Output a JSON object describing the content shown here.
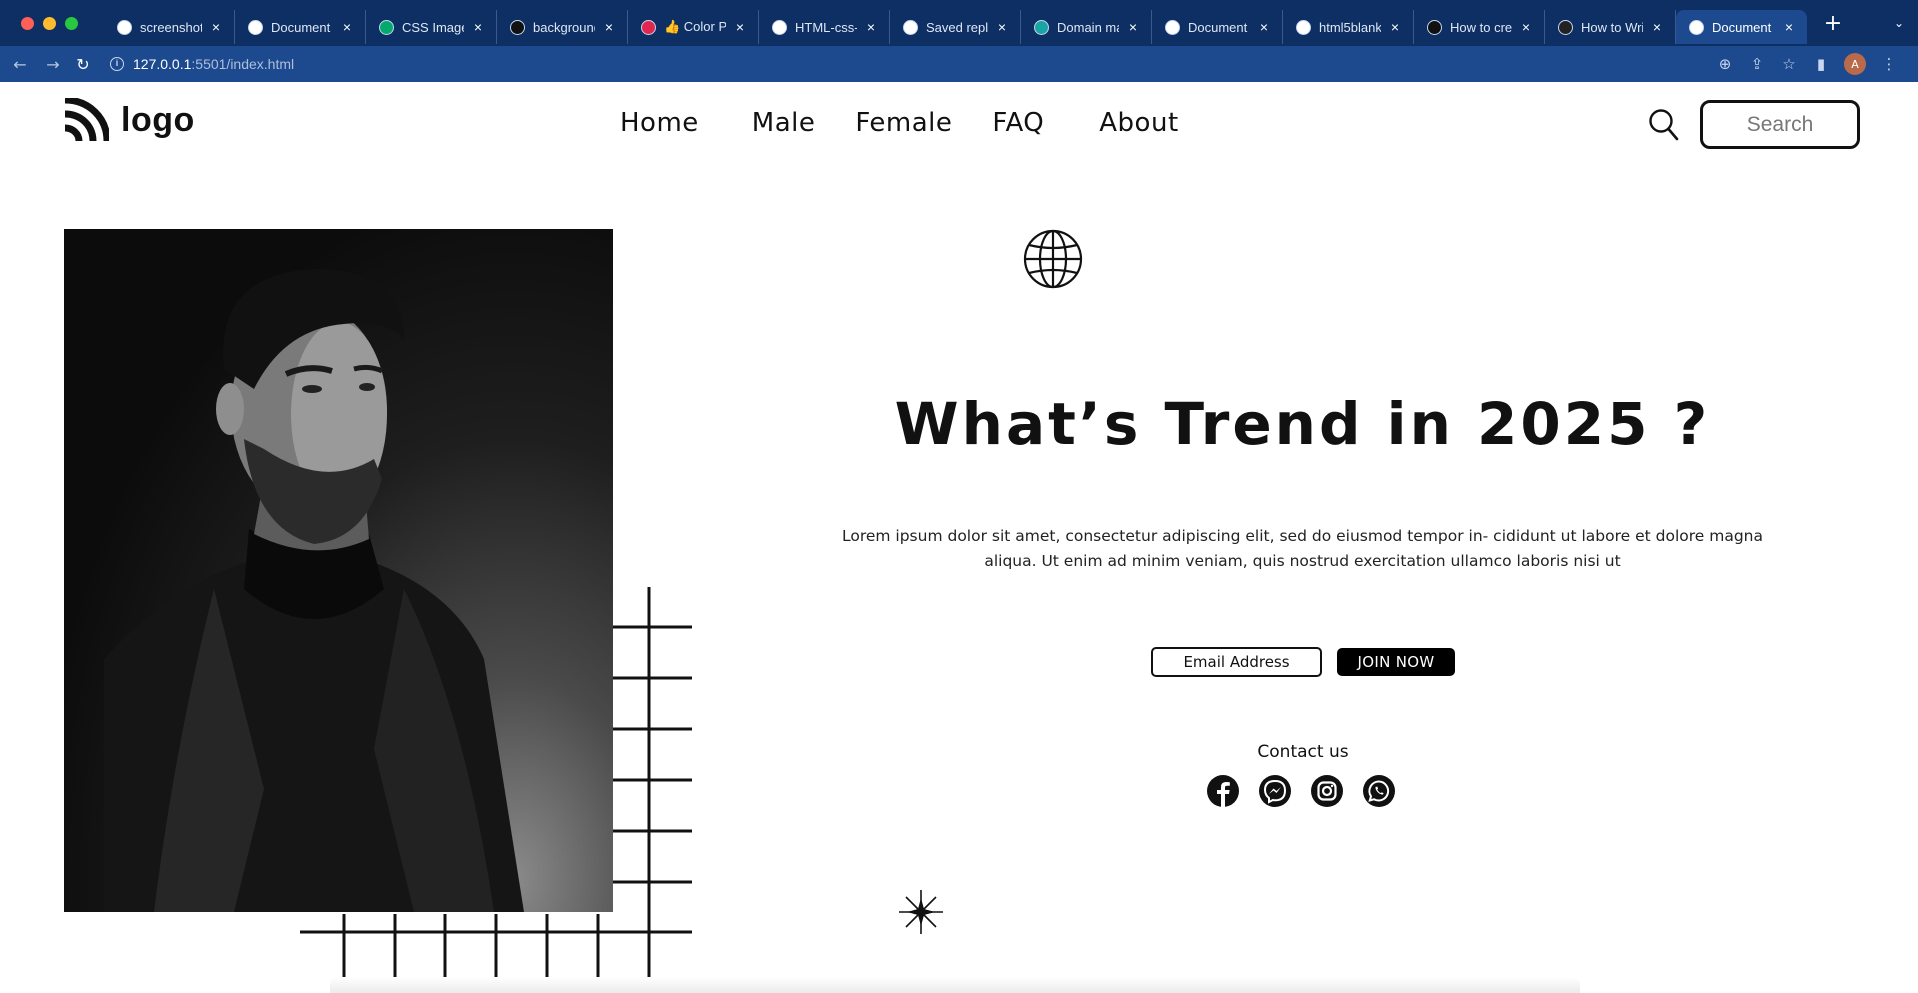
{
  "browser": {
    "tabs": [
      {
        "title": "screenshot",
        "favicon": "google-icon",
        "color": "#ffffff"
      },
      {
        "title": "Document",
        "favicon": "globe-icon",
        "color": "#ffffff"
      },
      {
        "title": "CSS Image",
        "favicon": "w3schools-icon",
        "color": "#04aa6d"
      },
      {
        "title": "background",
        "favicon": "medium-m-icon",
        "color": "#111111"
      },
      {
        "title": "👍 Color Pi",
        "favicon": "color-picker-icon",
        "color": "#e0264e"
      },
      {
        "title": "HTML-css-",
        "favicon": "github-icon",
        "color": "#ffffff"
      },
      {
        "title": "Saved repli",
        "favicon": "github-icon",
        "color": "#ffffff"
      },
      {
        "title": "Domain ma",
        "favicon": "diamond-icon",
        "color": "#1aa5a5"
      },
      {
        "title": "Document",
        "favicon": "globe-icon",
        "color": "#ffffff"
      },
      {
        "title": "html5blank",
        "favicon": "github-icon",
        "color": "#ffffff"
      },
      {
        "title": "How to crea",
        "favicon": "medium-icon",
        "color": "#111111"
      },
      {
        "title": "How to Writ",
        "favicon": "ai-icon",
        "color": "#222222"
      },
      {
        "title": "Document",
        "favicon": "globe-icon",
        "color": "#ffffff",
        "active": true
      }
    ],
    "new_tab": "+",
    "url_host": "127.0.0.1",
    "url_rest": ":5501/index.html",
    "profile_initial": "A"
  },
  "header": {
    "logo_text": "logo",
    "nav": [
      "Home",
      "Male",
      "Female",
      "FAQ",
      "About"
    ],
    "search_label": "Search"
  },
  "hero": {
    "headline": "What’s Trend in 2025 ?",
    "lead": "Lorem ipsum dolor sit amet, consectetur adipiscing elit, sed do eiusmod tempor in- cididunt ut labore et dolore magna aliqua. Ut enim ad minim veniam, quis nostrud exercitation ullamco laboris nisi ut",
    "email_button": "Email Address",
    "join_button": "JOIN NOW",
    "contact_label": "Contact us",
    "socials": [
      "facebook-icon",
      "messenger-icon",
      "instagram-icon",
      "whatsapp-icon"
    ]
  },
  "colors": {
    "chrome_dark": "#0d2f63",
    "chrome_light": "#1d4a8e",
    "text": "#111111",
    "join_bg": "#000000"
  }
}
